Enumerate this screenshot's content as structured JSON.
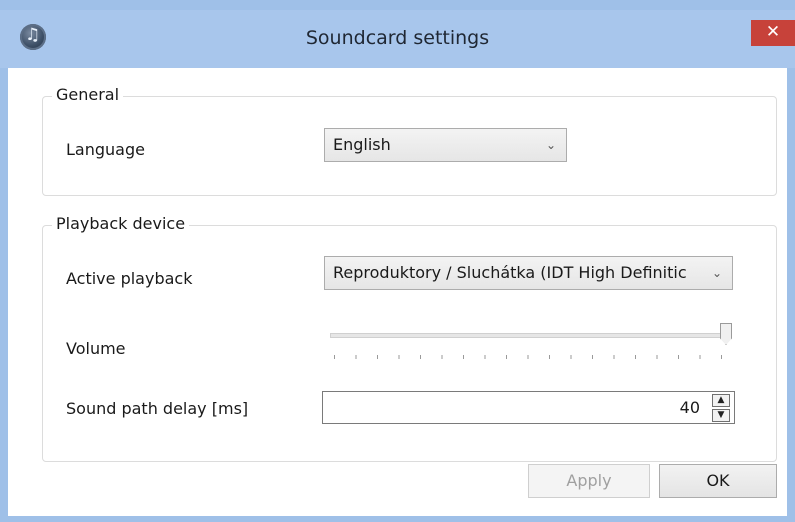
{
  "window": {
    "title": "Soundcard settings",
    "close_label": "✕"
  },
  "general": {
    "group_title": "General",
    "language_label": "Language",
    "language_value": "English"
  },
  "playback": {
    "group_title": "Playback device",
    "active_label": "Active playback",
    "active_value": "Reproduktory / Sluchátka (IDT High Definitic",
    "volume_label": "Volume",
    "volume_level": 1.0,
    "delay_label": "Sound path delay [ms]",
    "delay_value": "40"
  },
  "buttons": {
    "apply": "Apply",
    "ok": "OK"
  },
  "icons": {
    "app": "music-note-icon",
    "dropdown": "chevron-down-icon",
    "spin_up": "triangle-up-icon",
    "spin_down": "triangle-down-icon"
  }
}
